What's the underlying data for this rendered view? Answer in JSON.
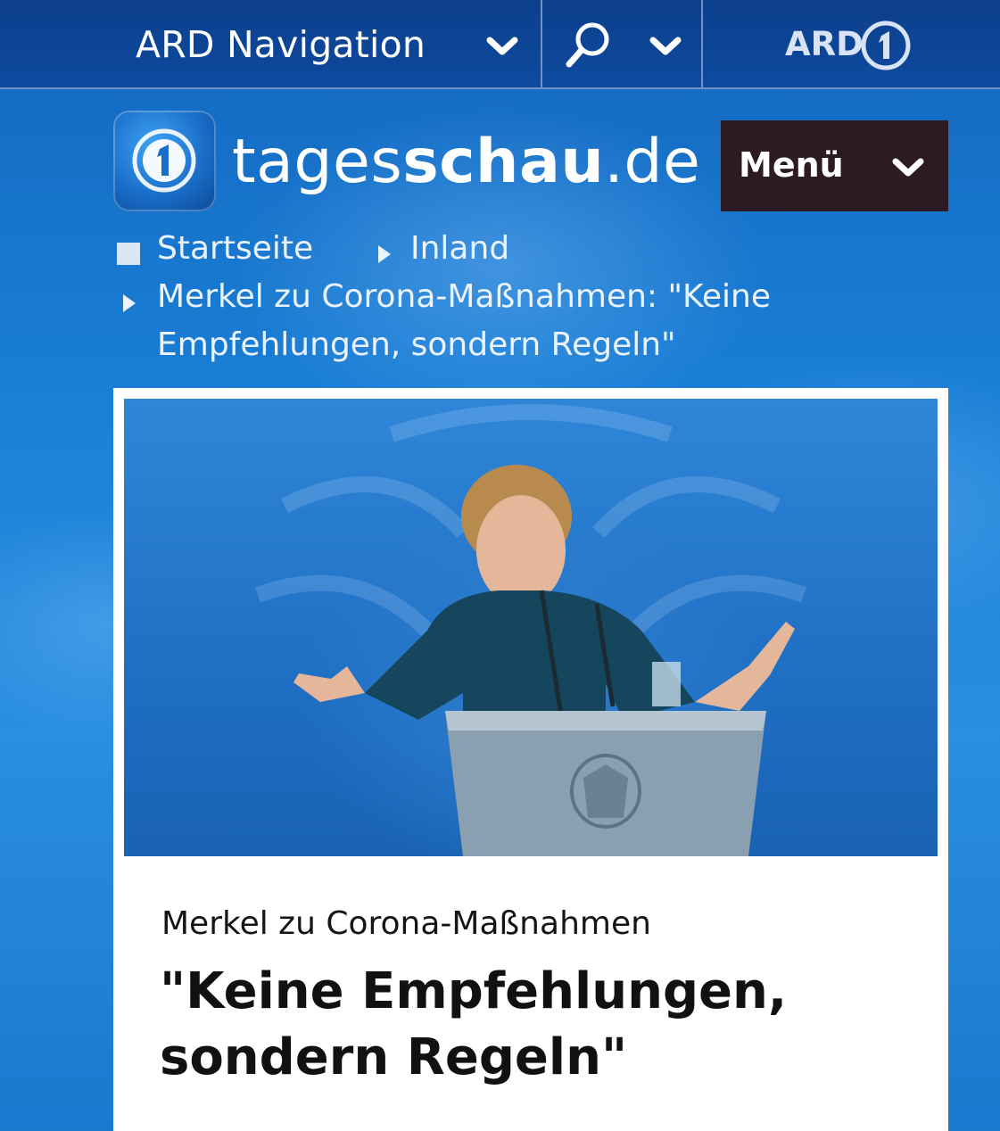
{
  "ard_bar": {
    "nav_label": "ARD Navigation",
    "logo_text": "ARD"
  },
  "site": {
    "wordmark_regular": "tages",
    "wordmark_bold": "schau",
    "wordmark_suffix": ".de",
    "menu_label": "Menü"
  },
  "breadcrumb": {
    "items": [
      "Startseite",
      "Inland",
      "Merkel zu Corona-Maßnahmen: \"Keine",
      "Empfehlungen, sondern Regeln\""
    ]
  },
  "article": {
    "kicker": "Merkel zu Corona-Maßnahmen",
    "headline_line1": "\"Keine Empfehlungen,",
    "headline_line2": "sondern Regeln\""
  },
  "colors": {
    "ard_bar": "#0e4a9e",
    "menu_button": "#2c1b22",
    "page_background": "#1a7fd6"
  },
  "icons": {
    "nav_dropdown": "chevron-down-icon",
    "search": "search-icon",
    "search_dropdown": "chevron-down-icon",
    "ard_logo": "ard-one-logo",
    "tagesschau_logo": "tagesschau-logo",
    "menu_dropdown": "chevron-down-icon",
    "breadcrumb_home": "square-bullet-icon",
    "breadcrumb_arrow": "triangle-right-icon"
  }
}
